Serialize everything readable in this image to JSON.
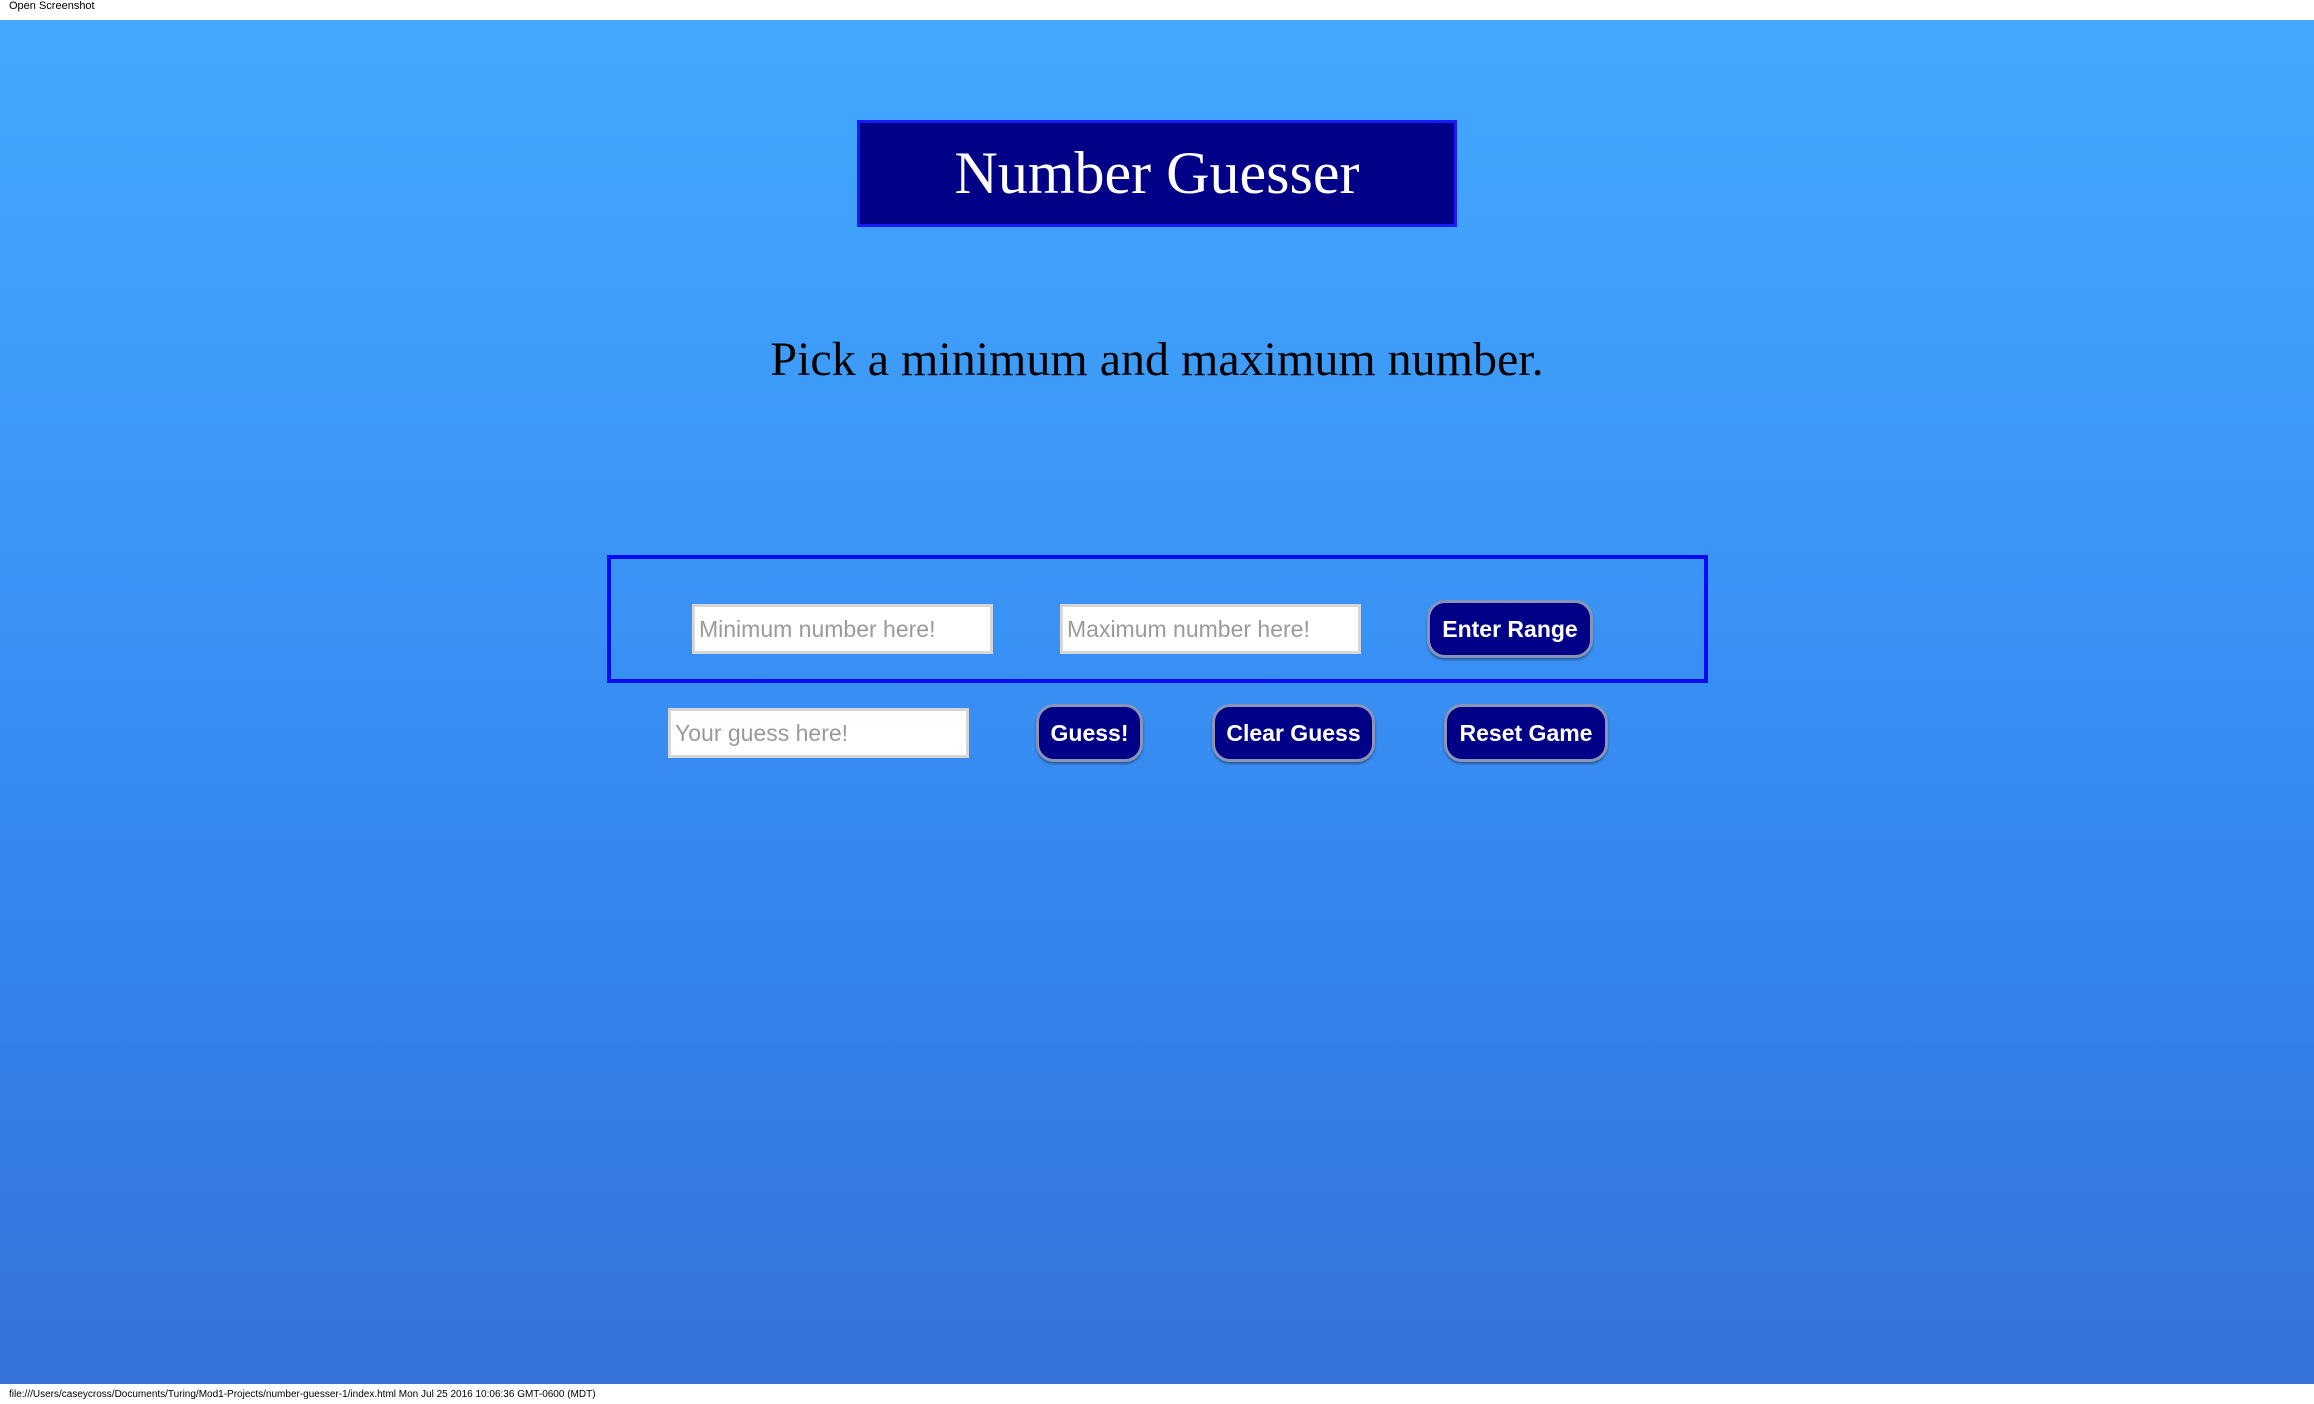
{
  "window": {
    "top_label": "Open Screenshot",
    "footer_text": "file:///Users/caseycross/Documents/Turing/Mod1-Projects/number-guesser-1/index.html Mon Jul 25 2016 10:06:36 GMT-0600 (MDT)"
  },
  "header": {
    "title": "Number Guesser"
  },
  "main": {
    "instructions": "Pick a minimum and maximum number."
  },
  "range": {
    "min_placeholder": "Minimum number here!",
    "min_value": "",
    "max_placeholder": "Maximum number here!",
    "max_value": "",
    "enter_range_label": "Enter Range"
  },
  "guess": {
    "guess_placeholder": "Your guess here!",
    "guess_value": "",
    "guess_button_label": "Guess!",
    "clear_button_label": "Clear Guess",
    "reset_button_label": "Reset Game"
  },
  "colors": {
    "background_top": "#43a9fd",
    "background_bottom": "#3573d8",
    "title_background": "#010087",
    "title_border": "#1a1aff",
    "range_border": "#0a0af0",
    "button_background": "#010087",
    "button_text": "#ffffff"
  }
}
